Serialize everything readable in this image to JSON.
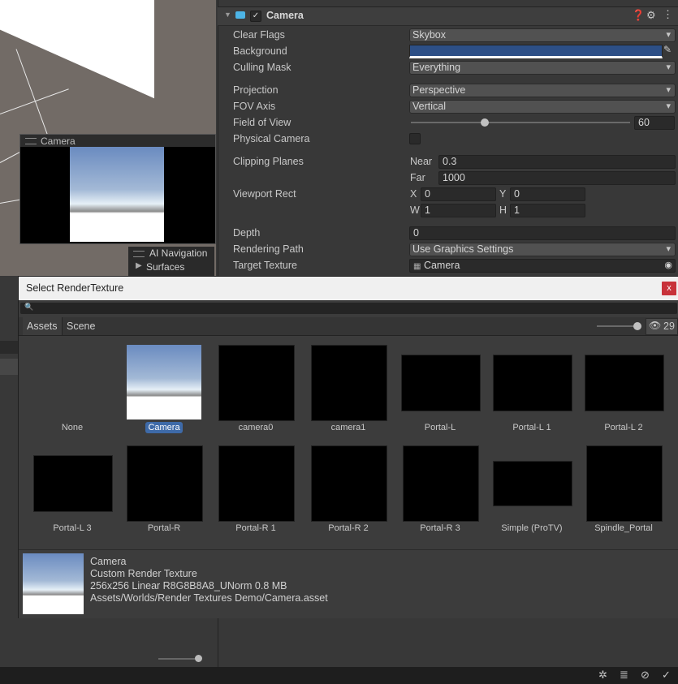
{
  "scene": {
    "camera_preview_title": "Camera",
    "ai_nav_title": "AI Navigation",
    "ai_nav_item": "Surfaces"
  },
  "inspector": {
    "component_title": "Camera",
    "rows": {
      "clear_flags": {
        "label": "Clear Flags",
        "value": "Skybox"
      },
      "background": {
        "label": "Background",
        "color": "#2d4f86"
      },
      "culling_mask": {
        "label": "Culling Mask",
        "value": "Everything"
      },
      "projection": {
        "label": "Projection",
        "value": "Perspective"
      },
      "fov_axis": {
        "label": "FOV Axis",
        "value": "Vertical"
      },
      "field_of_view": {
        "label": "Field of View",
        "value": "60"
      },
      "physical_camera": {
        "label": "Physical Camera"
      },
      "clipping_planes": {
        "label": "Clipping Planes",
        "near_label": "Near",
        "near": "0.3",
        "far_label": "Far",
        "far": "1000"
      },
      "viewport_rect": {
        "label": "Viewport Rect",
        "x_label": "X",
        "x": "0",
        "y_label": "Y",
        "y": "0",
        "w_label": "W",
        "w": "1",
        "h_label": "H",
        "h": "1"
      },
      "depth": {
        "label": "Depth",
        "value": "0"
      },
      "rendering_path": {
        "label": "Rendering Path",
        "value": "Use Graphics Settings"
      },
      "target_texture": {
        "label": "Target Texture",
        "value": "Camera"
      }
    }
  },
  "dialog": {
    "title": "Select RenderTexture",
    "close_label": "x",
    "tabs": [
      "Assets",
      "Scene"
    ],
    "hidden_count": "29",
    "items": [
      {
        "label": "None",
        "kind": "none"
      },
      {
        "label": "Camera",
        "kind": "sky",
        "selected": true
      },
      {
        "label": "camera0",
        "kind": "square"
      },
      {
        "label": "camera1",
        "kind": "square"
      },
      {
        "label": "Portal-L",
        "kind": "wide"
      },
      {
        "label": "Portal-L 1",
        "kind": "wide"
      },
      {
        "label": "Portal-L 2",
        "kind": "wide"
      },
      {
        "label": "Portal-L 3",
        "kind": "wide"
      },
      {
        "label": "Portal-R",
        "kind": "square"
      },
      {
        "label": "Portal-R 1",
        "kind": "square"
      },
      {
        "label": "Portal-R 2",
        "kind": "square"
      },
      {
        "label": "Portal-R 3",
        "kind": "square"
      },
      {
        "label": "Simple (ProTV)",
        "kind": "short"
      },
      {
        "label": "Spindle_Portal",
        "kind": "square"
      }
    ],
    "preview": {
      "name": "Camera",
      "type": "Custom Render Texture",
      "info": "256x256 Linear  R8G8B8A8_UNorm  0.8 MB",
      "path": "Assets/Worlds/Render Textures Demo/Camera.asset"
    }
  },
  "colors": {
    "accent": "#3e6aa8",
    "close_button": "#c8323a",
    "camera_icon": "#4db4e6"
  }
}
